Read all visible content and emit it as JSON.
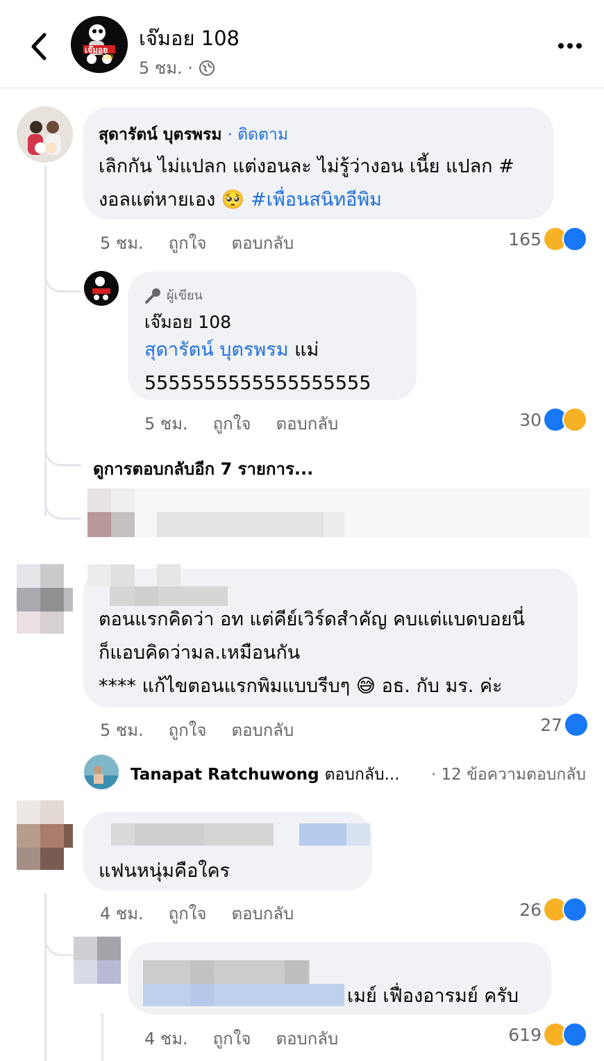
{
  "header": {
    "page_name": "เจ๊มอย 108",
    "post_time": "5 ชม. ·",
    "page_logo_text": "เจ๊มอย",
    "page_logo_sub": "108"
  },
  "comments": [
    {
      "author": "สุดารัตน์ บุตรพรม",
      "follow": "· ติดตาม",
      "text_line1": "เลิกกัน ไม่แปลก แต่งอนละ ไม่รู้ว่างอน เนี้ย แปลก #",
      "text_line2_prefix": "งอลแต่หายเอง",
      "text_line2_emoji": "🥺",
      "text_line2_tag": "#เพื่อนสนิทอีพิม",
      "time": "5 ชม.",
      "like": "ถูกใจ",
      "reply": "ตอบกลับ",
      "reaction_count": "165",
      "reactions": [
        "haha",
        "like"
      ]
    },
    {
      "author_badge": "ผู้เขียน",
      "author": "เจ๊มอย 108",
      "mention": "สุดารัตน์ บุตรพรม",
      "text_suffix": "แม่",
      "text_line2": "5555555555555555555",
      "time": "5 ชม.",
      "like": "ถูกใจ",
      "reply": "ตอบกลับ",
      "reaction_count": "30",
      "reactions": [
        "like",
        "haha"
      ]
    },
    {
      "text_line1": "ตอนแรกคิดว่า อท แต่คีย์เวิร์ดสำคัญ คบแต่แบดบอยนี่",
      "text_line2": "ก็แอบคิดว่ามล.เหมือนกัน",
      "text_line3_prefix": "**** แก้ไขตอนแรกพิมแบบรีบๆ",
      "text_line3_emoji": "😅",
      "text_line3_suffix": "อธ. กับ มร. ค่ะ",
      "time": "5 ชม.",
      "like": "ถูกใจ",
      "reply": "ตอบกลับ",
      "reaction_count": "27",
      "reactions": [
        "like"
      ]
    },
    {
      "text_line1": "แฟนหนุ่มคือใคร",
      "time": "4 ชม.",
      "like": "ถูกใจ",
      "reply": "ตอบกลับ",
      "reaction_count": "26",
      "reactions": [
        "haha",
        "like"
      ]
    },
    {
      "text_suffix": "เมย์ เฟื่องอารมย์ ครับ",
      "time": "4 ชม.",
      "like": "ถูกใจ",
      "reply": "ตอบกลับ",
      "reaction_count": "619",
      "reactions": [
        "haha",
        "like"
      ]
    }
  ],
  "view_more_replies": "ดูการตอบกลับอีก 7 รายการ...",
  "reply_summary": {
    "name": "Tanapat Ratchuwong",
    "action": "ตอบกลับ...",
    "count": "· 12 ข้อความตอบกลับ"
  },
  "colors": {
    "link": "#216fdb",
    "like": "#1877f2",
    "haha": "#f7b125",
    "bubble": "#f0f2f5",
    "meta": "#65676b"
  }
}
